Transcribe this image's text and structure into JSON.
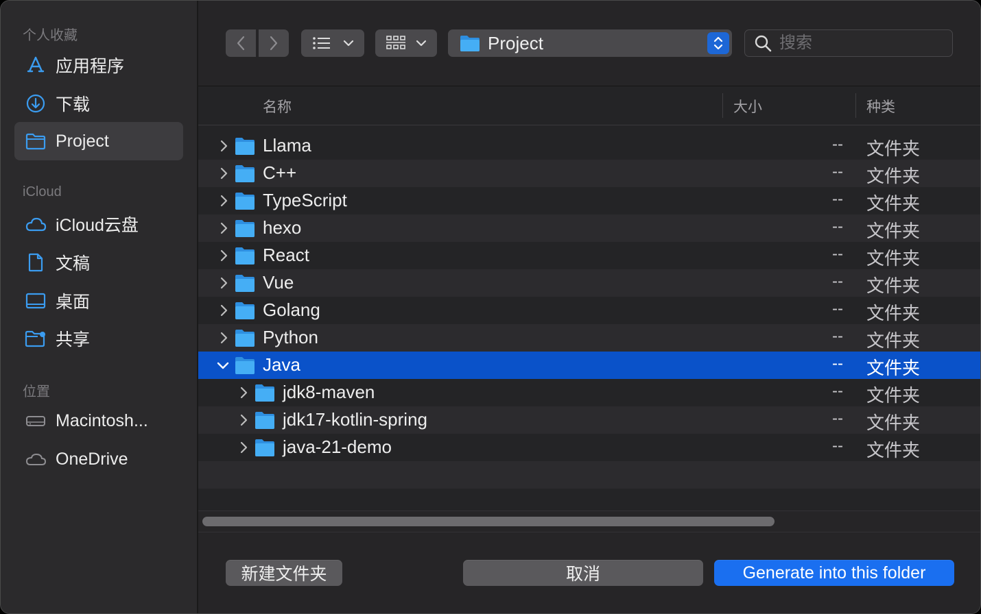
{
  "sidebar": {
    "favorites_title": "个人收藏",
    "favorites": [
      {
        "label": "应用程序",
        "icon": "applications-icon"
      },
      {
        "label": "下载",
        "icon": "downloads-icon"
      },
      {
        "label": "Project",
        "icon": "folder-icon",
        "selected": true
      }
    ],
    "icloud_title": "iCloud",
    "icloud": [
      {
        "label": "iCloud云盘",
        "icon": "icloud-icon"
      },
      {
        "label": "文稿",
        "icon": "document-icon"
      },
      {
        "label": "桌面",
        "icon": "desktop-icon"
      },
      {
        "label": "共享",
        "icon": "shared-folder-icon"
      }
    ],
    "locations_title": "位置",
    "locations": [
      {
        "label": "Macintosh...",
        "icon": "disk-icon"
      },
      {
        "label": "OneDrive",
        "icon": "cloud-icon"
      }
    ]
  },
  "toolbar": {
    "path": "Project",
    "search_placeholder": "搜索"
  },
  "columns": {
    "name": "名称",
    "size": "大小",
    "kind": "种类"
  },
  "files": [
    {
      "name": "Llama",
      "size": "--",
      "kind": "文件夹",
      "depth": 0,
      "expanded": false
    },
    {
      "name": "C++",
      "size": "--",
      "kind": "文件夹",
      "depth": 0,
      "expanded": false
    },
    {
      "name": "TypeScript",
      "size": "--",
      "kind": "文件夹",
      "depth": 0,
      "expanded": false
    },
    {
      "name": "hexo",
      "size": "--",
      "kind": "文件夹",
      "depth": 0,
      "expanded": false
    },
    {
      "name": "React",
      "size": "--",
      "kind": "文件夹",
      "depth": 0,
      "expanded": false
    },
    {
      "name": "Vue",
      "size": "--",
      "kind": "文件夹",
      "depth": 0,
      "expanded": false
    },
    {
      "name": "Golang",
      "size": "--",
      "kind": "文件夹",
      "depth": 0,
      "expanded": false
    },
    {
      "name": "Python",
      "size": "--",
      "kind": "文件夹",
      "depth": 0,
      "expanded": false
    },
    {
      "name": "Java",
      "size": "--",
      "kind": "文件夹",
      "depth": 0,
      "expanded": true,
      "selected": true
    },
    {
      "name": "jdk8-maven",
      "size": "--",
      "kind": "文件夹",
      "depth": 1,
      "expanded": false
    },
    {
      "name": "jdk17-kotlin-spring",
      "size": "--",
      "kind": "文件夹",
      "depth": 1,
      "expanded": false
    },
    {
      "name": "java-21-demo",
      "size": "--",
      "kind": "文件夹",
      "depth": 1,
      "expanded": false
    }
  ],
  "buttons": {
    "new_folder": "新建文件夹",
    "cancel": "取消",
    "confirm": "Generate into this folder"
  },
  "colors": {
    "accent": "#1a6ff0",
    "selection": "#0a52c9",
    "folder": "#3aa0ec"
  }
}
